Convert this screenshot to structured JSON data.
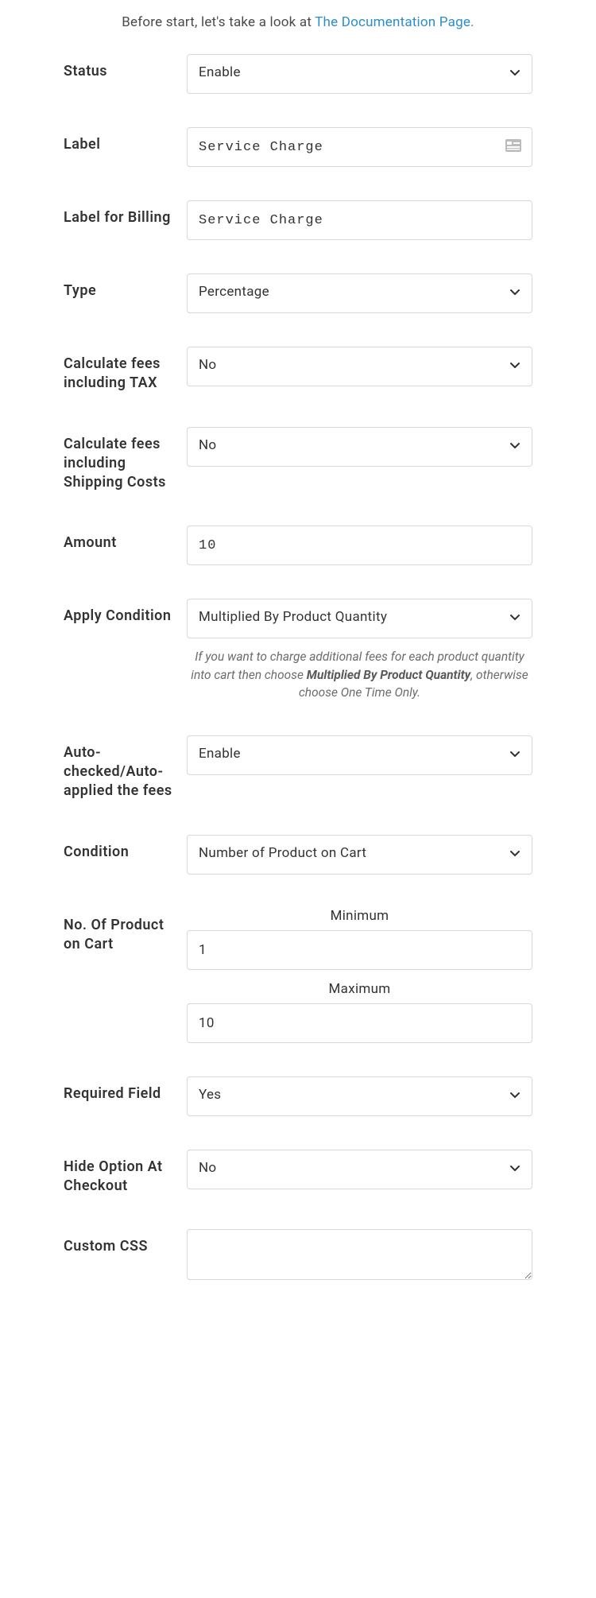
{
  "intro": {
    "prefix": "Before start, let's take a look at ",
    "link": "The Documentation Page."
  },
  "fields": {
    "status": {
      "label": "Status",
      "value": "Enable"
    },
    "label": {
      "label": "Label",
      "value": "Service Charge"
    },
    "labelBilling": {
      "label": "Label for Billing",
      "value": "Service Charge"
    },
    "type": {
      "label": "Type",
      "value": "Percentage"
    },
    "calcTax": {
      "label": "Calculate fees including TAX",
      "value": "No"
    },
    "calcShipping": {
      "label": "Calculate fees including Shipping Costs",
      "value": "No"
    },
    "amount": {
      "label": "Amount",
      "value": "10"
    },
    "applyCondition": {
      "label": "Apply Condition",
      "value": "Multiplied By Product Quantity",
      "helper1": "If you want to charge additional fees for each product quantity into cart then choose ",
      "helperBold": "Multiplied By Product Quantity",
      "helper2": ", otherwise choose One Time Only."
    },
    "autoApplied": {
      "label": "Auto-checked/Auto-applied the fees",
      "value": "Enable"
    },
    "condition": {
      "label": "Condition",
      "value": "Number of Product on Cart"
    },
    "productCart": {
      "label": "No. Of Product on Cart",
      "minLabel": "Minimum",
      "min": "1",
      "maxLabel": "Maximum",
      "max": "10"
    },
    "requiredField": {
      "label": "Required Field",
      "value": "Yes"
    },
    "hideCheckout": {
      "label": "Hide Option At Checkout",
      "value": "No"
    },
    "customCss": {
      "label": "Custom CSS",
      "value": ""
    }
  }
}
